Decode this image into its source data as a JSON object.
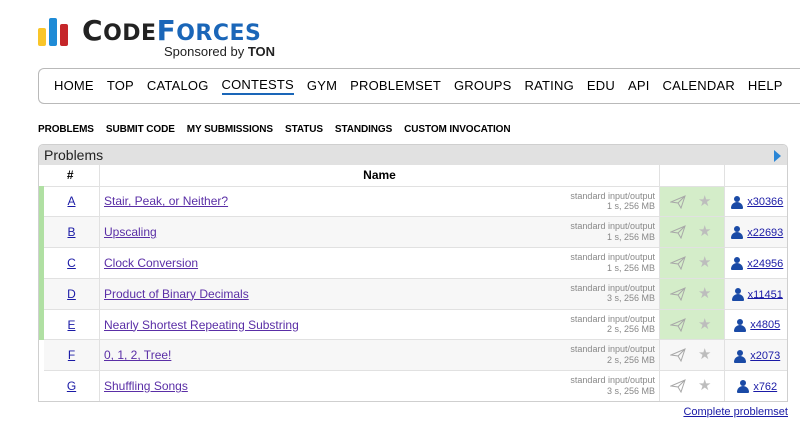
{
  "logo": {
    "text_a": "C",
    "text_a_small": "ODE",
    "text_b": "F",
    "text_b_small": "ORCES",
    "sponsor_prefix": "Sponsored by ",
    "sponsor_name": "TON"
  },
  "menu": {
    "items": [
      "HOME",
      "TOP",
      "CATALOG",
      "CONTESTS",
      "GYM",
      "PROBLEMSET",
      "GROUPS",
      "RATING",
      "EDU",
      "API",
      "CALENDAR",
      "HELP"
    ],
    "active": "CONTESTS"
  },
  "submenu": {
    "items": [
      "PROBLEMS",
      "SUBMIT CODE",
      "MY SUBMISSIONS",
      "STATUS",
      "STANDINGS",
      "CUSTOM INVOCATION"
    ]
  },
  "problems": {
    "title": "Problems",
    "headers": {
      "index": "#",
      "name": "Name"
    },
    "rows": [
      {
        "index": "A",
        "name": "Stair, Peak, or Neither?",
        "io": "standard input/output",
        "limits": "1 s, 256 MB",
        "solved": "x30366",
        "accepted": true
      },
      {
        "index": "B",
        "name": "Upscaling",
        "io": "standard input/output",
        "limits": "1 s, 256 MB",
        "solved": "x22693",
        "accepted": true
      },
      {
        "index": "C",
        "name": "Clock Conversion",
        "io": "standard input/output",
        "limits": "1 s, 256 MB",
        "solved": "x24956",
        "accepted": true
      },
      {
        "index": "D",
        "name": "Product of Binary Decimals",
        "io": "standard input/output",
        "limits": "3 s, 256 MB",
        "solved": "x11451",
        "accepted": true
      },
      {
        "index": "E",
        "name": "Nearly Shortest Repeating Substring",
        "io": "standard input/output",
        "limits": "2 s, 256 MB",
        "solved": "x4805",
        "accepted": true
      },
      {
        "index": "F",
        "name": "0, 1, 2, Tree!",
        "io": "standard input/output",
        "limits": "2 s, 256 MB",
        "solved": "x2073",
        "accepted": false
      },
      {
        "index": "G",
        "name": "Shuffling Songs",
        "io": "standard input/output",
        "limits": "3 s, 256 MB",
        "solved": "x762",
        "accepted": false
      }
    ]
  },
  "footer": {
    "complete_link": "Complete problemset"
  },
  "colors": {
    "accent": "#1a66b8",
    "accepted_bg": "#d4edc9",
    "accepted_bar": "#b0e0a3"
  }
}
